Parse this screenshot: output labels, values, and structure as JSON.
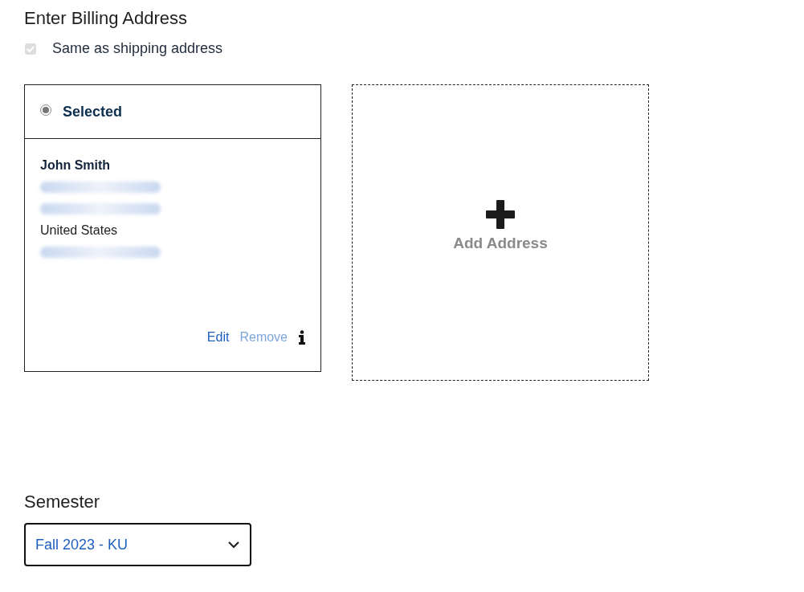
{
  "billing": {
    "title": "Enter Billing Address",
    "same_as_shipping": {
      "label": "Same as shipping address",
      "checked": true,
      "disabled": true
    }
  },
  "address_card": {
    "header": "Selected",
    "selected": true,
    "name": "John Smith",
    "lines": [
      {
        "kind": "redacted"
      },
      {
        "kind": "redacted"
      },
      {
        "kind": "text",
        "text": "United States"
      },
      {
        "kind": "redacted"
      }
    ],
    "actions": [
      {
        "label": "Edit",
        "disabled": false
      },
      {
        "label": "Remove",
        "disabled": true
      }
    ]
  },
  "add_address": {
    "label": "Add Address"
  },
  "semester": {
    "label": "Semester",
    "value": "Fall 2023 - KU"
  }
}
